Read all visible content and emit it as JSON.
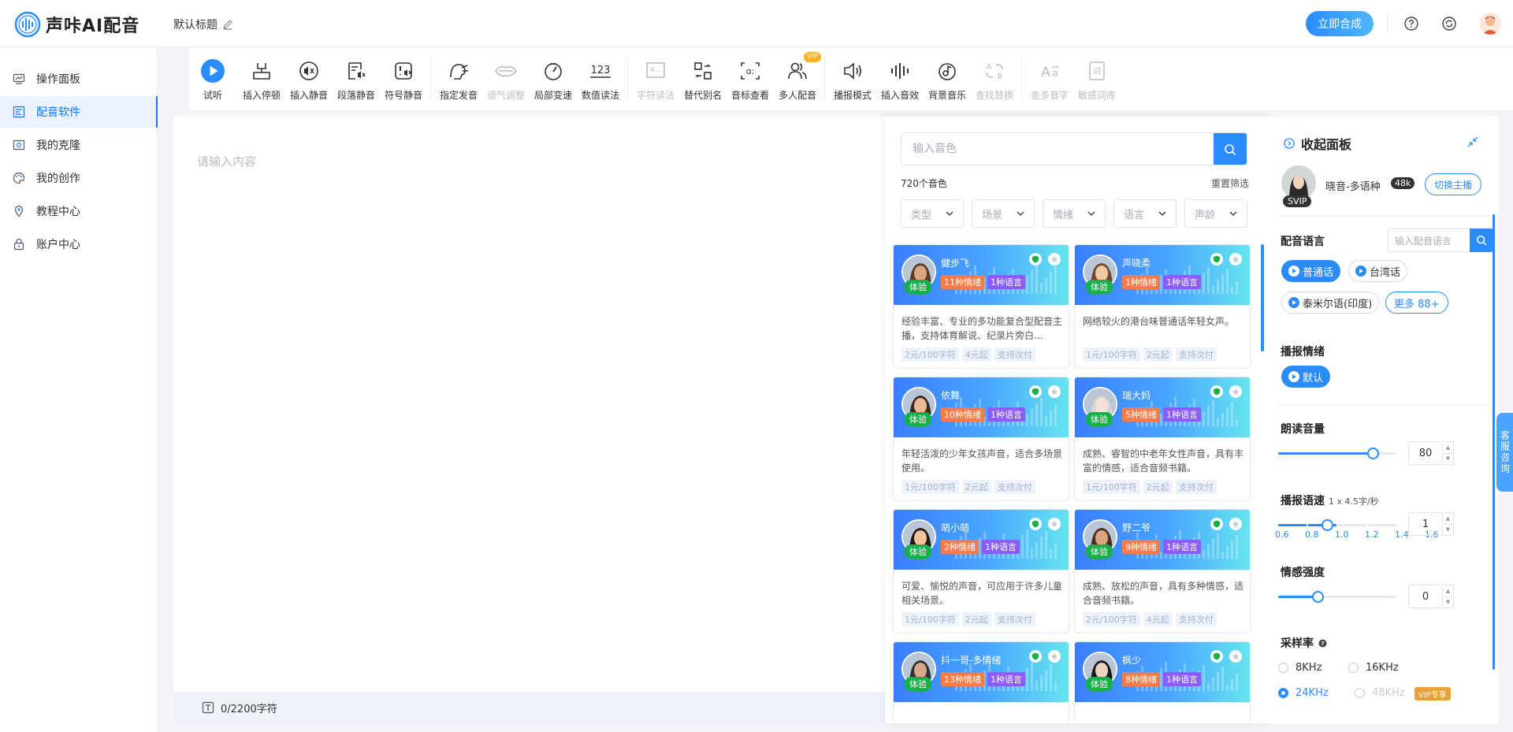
{
  "header": {
    "app_name": "声咔AI配音",
    "doc_title": "默认标题",
    "synth_label": "立即合成",
    "brand_color": "#2a8cff"
  },
  "sidebar": {
    "items": [
      {
        "label": "操作面板",
        "icon": "dashboard-icon"
      },
      {
        "label": "配音软件",
        "icon": "dubbing-icon",
        "active": true
      },
      {
        "label": "我的克隆",
        "icon": "clone-icon"
      },
      {
        "label": "我的创作",
        "icon": "palette-icon"
      },
      {
        "label": "教程中心",
        "icon": "tutorial-icon"
      },
      {
        "label": "账户中心",
        "icon": "account-icon"
      }
    ]
  },
  "toolbar": {
    "items": [
      {
        "label": "试听",
        "icon": "play-icon"
      },
      {
        "label": "插入停顿",
        "icon": "pause-insert-icon"
      },
      {
        "label": "插入静音",
        "icon": "mute-insert-icon"
      },
      {
        "label": "段落静音",
        "icon": "paragraph-mute-icon"
      },
      {
        "label": "符号静音",
        "icon": "symbol-mute-icon"
      },
      {
        "label": "指定发音",
        "icon": "pronunciation-icon"
      },
      {
        "label": "语气调整",
        "icon": "tone-icon",
        "disabled": true
      },
      {
        "label": "局部变速",
        "icon": "speed-icon"
      },
      {
        "label": "数值读法",
        "icon": "number-read-icon"
      },
      {
        "label": "字符读法",
        "icon": "char-read-icon",
        "disabled": true
      },
      {
        "label": "替代别名",
        "icon": "alias-icon"
      },
      {
        "label": "音标查看",
        "icon": "phonetic-icon"
      },
      {
        "label": "多人配音",
        "icon": "multi-voice-icon"
      },
      {
        "label": "播报模式",
        "icon": "broadcast-icon"
      },
      {
        "label": "插入音效",
        "icon": "sound-effect-icon"
      },
      {
        "label": "背景音乐",
        "icon": "music-icon"
      },
      {
        "label": "查找替换",
        "icon": "find-replace-icon",
        "disabled": true
      },
      {
        "label": "查多音字",
        "icon": "polyphone-icon",
        "disabled": true
      },
      {
        "label": "敏感词库",
        "icon": "sensitive-words-icon",
        "disabled": true
      }
    ],
    "vip_tag": "VIP"
  },
  "editor": {
    "placeholder": "请输入内容",
    "char_count": "0/2200字符"
  },
  "voices": {
    "search_placeholder": "输入音色",
    "count": "720个音色",
    "reset": "重置筛选",
    "filters": [
      "类型",
      "场景",
      "情绪",
      "语言",
      "声龄"
    ],
    "trial_label": "体验",
    "cards": [
      {
        "name": "健步飞",
        "emotions": "11种情绪",
        "langs": "1种语言",
        "desc": "经验丰富、专业的多功能复合型配音主播，支持体育解说、纪录片旁白...",
        "tags": [
          "2元/100字符",
          "4元起",
          "支持次付"
        ]
      },
      {
        "name": "声晓柔",
        "emotions": "1种情绪",
        "langs": "1种语言",
        "desc": "网络较火的港台味普通话年轻女声。",
        "tags": [
          "1元/100字符",
          "2元起",
          "支持次付"
        ]
      },
      {
        "name": "依舞",
        "emotions": "10种情绪",
        "langs": "1种语言",
        "desc": "年轻活泼的少年女孩声音，适合多场景使用。",
        "tags": [
          "1元/100字符",
          "2元起",
          "支持次付"
        ]
      },
      {
        "name": "瑞大妈",
        "emotions": "5种情绪",
        "langs": "1种语言",
        "desc": "成熟、睿智的中老年女性声音，具有丰富的情感，适合音频书籍。",
        "tags": [
          "1元/100字符",
          "2元起",
          "支持次付"
        ]
      },
      {
        "name": "萌小萌",
        "emotions": "2种情绪",
        "langs": "1种语言",
        "desc": "可爱、愉悦的声音，可应用于许多儿童相关场景。",
        "tags": [
          "1元/100字符",
          "2元起",
          "支持次付"
        ]
      },
      {
        "name": "野二爷",
        "emotions": "9种情绪",
        "langs": "1种语言",
        "desc": "成熟、放松的声音，具有多种情感，适合音频书籍。",
        "tags": [
          "2元/100字符",
          "4元起",
          "支持次付"
        ]
      },
      {
        "name": "抖一哥-多情绪",
        "emotions": "13种情绪",
        "langs": "1种语言",
        "desc": "",
        "tags": []
      },
      {
        "name": "枫少",
        "emotions": "8种情绪",
        "langs": "1种语言",
        "desc": "",
        "tags": []
      }
    ]
  },
  "settings": {
    "collapse_title": "收起面板",
    "anchor": {
      "name": "晓音-多语种",
      "count": "48k",
      "badge": "SVIP",
      "switch_label": "切换主播"
    },
    "lang_label": "配音语言",
    "lang_search_placeholder": "输入配音语言",
    "langs": [
      {
        "label": "普通话",
        "on": true
      },
      {
        "label": "台湾话",
        "on": false
      },
      {
        "label": "泰米尔语(印度)",
        "on": false
      }
    ],
    "more_lang": "更多 88+",
    "emotion_label": "播报情绪",
    "emotion_default": "默认",
    "volume_label": "朗读音量",
    "volume_value": "80",
    "volume_fraction": 0.8,
    "speed_label": "播报语速",
    "speed_hint": "1 x 4.5字/秒",
    "speed_value": "1",
    "speed_ticks": [
      "0.6",
      "0.8",
      "1.0",
      "1.2",
      "1.4",
      "1.6"
    ],
    "intensity_label": "情感强度",
    "intensity_value": "0",
    "intensity_fraction": 0.33,
    "sample_label": "采样率",
    "sample_rates": [
      {
        "label": "8KHz",
        "on": false,
        "disabled": false
      },
      {
        "label": "16KHz",
        "on": false,
        "disabled": false
      },
      {
        "label": "24KHz",
        "on": true,
        "disabled": false
      },
      {
        "label": "48KHz",
        "on": false,
        "disabled": true
      }
    ],
    "vip_only": "VIP专享"
  },
  "customer_service": "客服咨询"
}
